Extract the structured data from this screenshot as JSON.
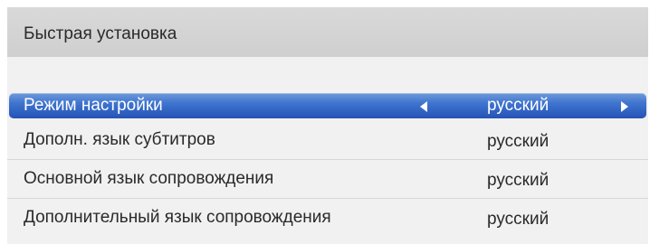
{
  "panel": {
    "title": "Быстрая установка"
  },
  "settings": [
    {
      "label": "Режим настройки",
      "value": "русский",
      "selected": true
    },
    {
      "label": "Дополн. язык субтитров",
      "value": "русский",
      "selected": false
    },
    {
      "label": "Основной язык сопровождения",
      "value": "русский",
      "selected": false
    },
    {
      "label": "Дополнительный язык сопровождения",
      "value": "русский",
      "selected": false
    }
  ],
  "colors": {
    "selection": "#3f74cf",
    "header": "#d4d4d4",
    "background": "#f1f1f1",
    "text": "#2a2a2a"
  }
}
